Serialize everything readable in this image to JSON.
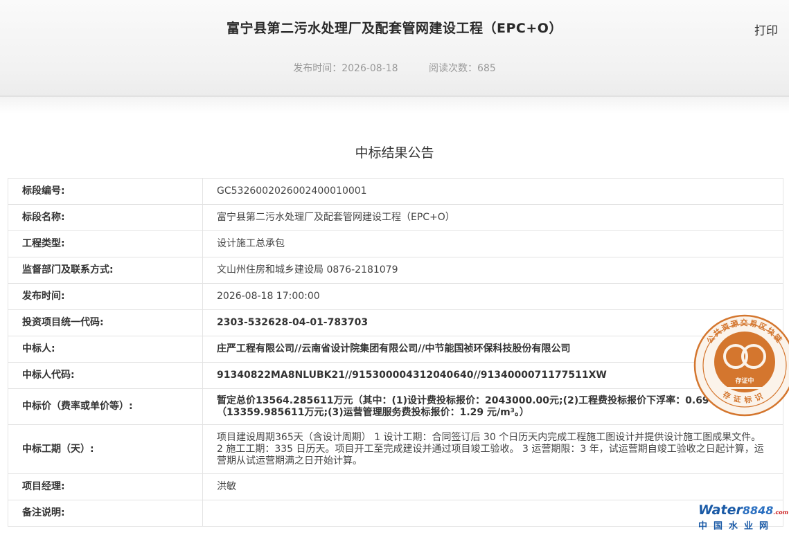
{
  "header": {
    "title": "富宁县第二污水处理厂及配套管网建设工程（EPC+O）",
    "print_label": "打印",
    "publish_label": "发布时间：2026-08-18",
    "views_label": "阅读次数：685"
  },
  "section_title": "中标结果公告",
  "rows": [
    {
      "label": "标段编号:",
      "value": "GC5326002026002400010001"
    },
    {
      "label": "标段名称:",
      "value": "富宁县第二污水处理厂及配套管网建设工程（EPC+O）"
    },
    {
      "label": "工程类型:",
      "value": "设计施工总承包"
    },
    {
      "label": "监督部门及联系方式:",
      "value": "文山州住房和城乡建设局 0876-2181079"
    },
    {
      "label": "发布时间:",
      "value": "2026-08-18 17:00:00"
    },
    {
      "label": "投资项目统一代码:",
      "value": "2303-532628-04-01-783703"
    },
    {
      "label": "中标人:",
      "value": "庄严工程有限公司//云南省设计院集团有限公司//中节能国祯环保科技股份有限公司"
    },
    {
      "label": "中标人代码:",
      "value": "91340822MA8NLUBK21//915300004312040640//9134000071177511XW"
    },
    {
      "label": "中标价（费率或单价等）:",
      "value": "暂定总价13564.285611万元（其中：(1)设计费投标报价：2043000.00元;(2)工程费投标报价下浮率：0.69%，（13359.985611万元;(3)运营管理服务费投标报价：1.29 元/m³。）"
    },
    {
      "label": "中标工期（天）:",
      "value": "项目建设周期365天（含设计周期） 1 设计工期：合同签订后 30 个日历天内完成工程施工图设计并提供设计施工图成果文件。 2 施工工期：335 日历天。项目开工至完成建设并通过项目竣工验收。 3 运营期限：3 年，试运营期自竣工验收之日起计算，运营期从试运营期满之日开始计算。"
    },
    {
      "label": "项目经理:",
      "value": "洪敏"
    },
    {
      "label": "备注说明:",
      "value": ""
    }
  ],
  "seal": {
    "ring_text": "公共资源交易区块链",
    "inner_text": "存证中",
    "bottom_text": "存证标识",
    "color": "#d4762e"
  },
  "watermark": {
    "brand_word": "Water",
    "brand_num": "8848",
    "brand_tld": ".com",
    "brand_cn": "中国水业网"
  },
  "colors": {
    "accent_blue": "#1a5aa6",
    "seal_orange": "#d4762e"
  }
}
